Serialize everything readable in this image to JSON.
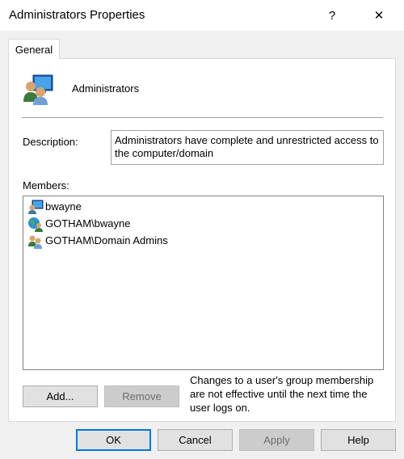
{
  "window": {
    "title": "Administrators Properties",
    "help_glyph": "?",
    "close_glyph": "✕"
  },
  "tabs": [
    {
      "label": "General",
      "selected": true
    }
  ],
  "general": {
    "group_name": "Administrators",
    "description_label": "Description:",
    "description_value": "Administrators have complete and unrestricted access to the computer/domain",
    "members_label": "Members:",
    "members": [
      {
        "name": "bwayne",
        "icon": "local-user-icon"
      },
      {
        "name": "GOTHAM\\bwayne",
        "icon": "domain-user-icon"
      },
      {
        "name": "GOTHAM\\Domain Admins",
        "icon": "domain-group-icon"
      }
    ],
    "add_label": "Add...",
    "remove_label": "Remove",
    "note": "Changes to a user's group membership are not effective until the next time the user logs on."
  },
  "footer": {
    "ok_label": "OK",
    "cancel_label": "Cancel",
    "apply_label": "Apply",
    "help_label": "Help"
  }
}
